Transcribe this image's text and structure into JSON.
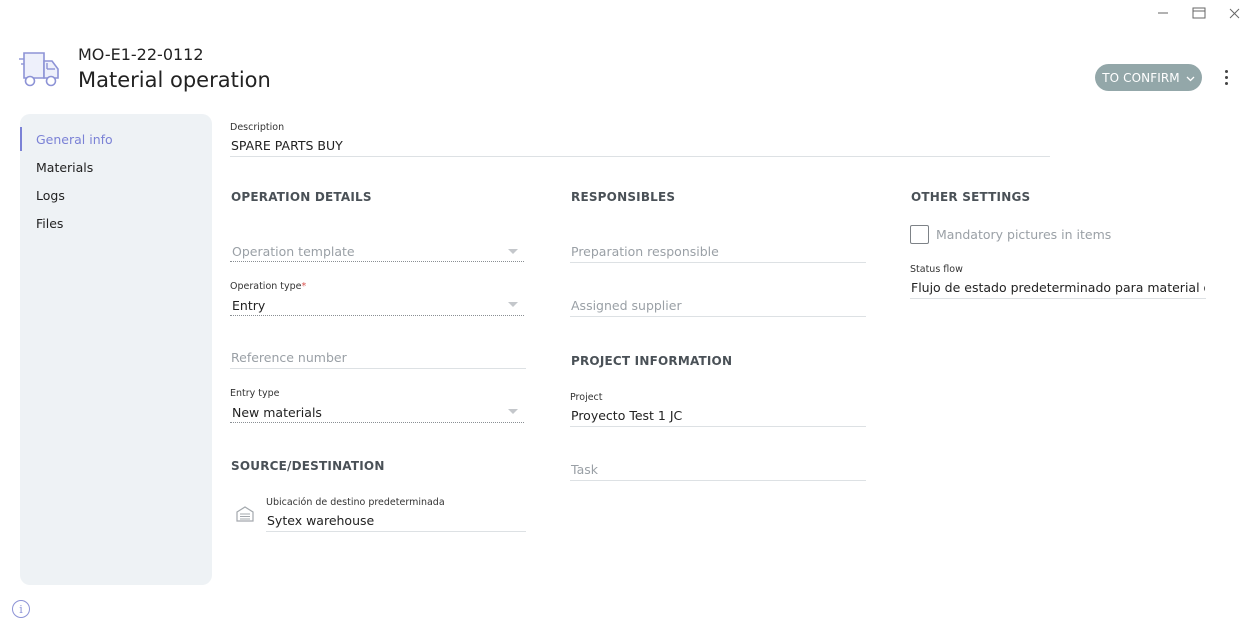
{
  "window": {
    "minimize_icon": "minimize-icon",
    "maximize_icon": "maximize-icon",
    "close_icon": "close-icon"
  },
  "header": {
    "icon": "truck-icon",
    "code": "MO-E1-22-0112",
    "title": "Material operation",
    "status_button": "TO CONFIRM",
    "status_color": "#93a7a9",
    "menu_icon": "kebab-menu-icon"
  },
  "sidebar": {
    "items": [
      {
        "label": "General info",
        "active": true
      },
      {
        "label": "Materials",
        "active": false
      },
      {
        "label": "Logs",
        "active": false
      },
      {
        "label": "Files",
        "active": false
      }
    ],
    "accent_color": "#7b82d6"
  },
  "form": {
    "description": {
      "label": "Description",
      "value": "SPARE PARTS BUY"
    },
    "operation_details": {
      "title": "OPERATION DETAILS",
      "operation_template": {
        "placeholder": "Operation template"
      },
      "operation_type": {
        "label": "Operation type",
        "required_mark": "*",
        "value": "Entry"
      },
      "reference_number": {
        "placeholder": "Reference number"
      },
      "entry_type": {
        "label": "Entry type",
        "value": "New materials"
      }
    },
    "source_destination": {
      "title": "SOURCE/DESTINATION",
      "destination": {
        "label": "Ubicación de destino predeterminada",
        "value": "Sytex warehouse",
        "icon": "warehouse-icon"
      }
    },
    "responsibles": {
      "title": "RESPONSIBLES",
      "preparation_responsible": {
        "placeholder": "Preparation responsible"
      },
      "assigned_supplier": {
        "placeholder": "Assigned supplier"
      }
    },
    "project_information": {
      "title": "PROJECT INFORMATION",
      "project": {
        "label": "Project",
        "value": "Proyecto Test 1 JC"
      },
      "task": {
        "placeholder": "Task"
      }
    },
    "other_settings": {
      "title": "OTHER SETTINGS",
      "mandatory_pictures": {
        "label": "Mandatory pictures in items",
        "checked": false
      },
      "status_flow": {
        "label": "Status flow",
        "value": "Flujo de estado predeterminado para material o..."
      }
    }
  },
  "footer": {
    "info_icon": "info-icon",
    "info_glyph": "i"
  }
}
